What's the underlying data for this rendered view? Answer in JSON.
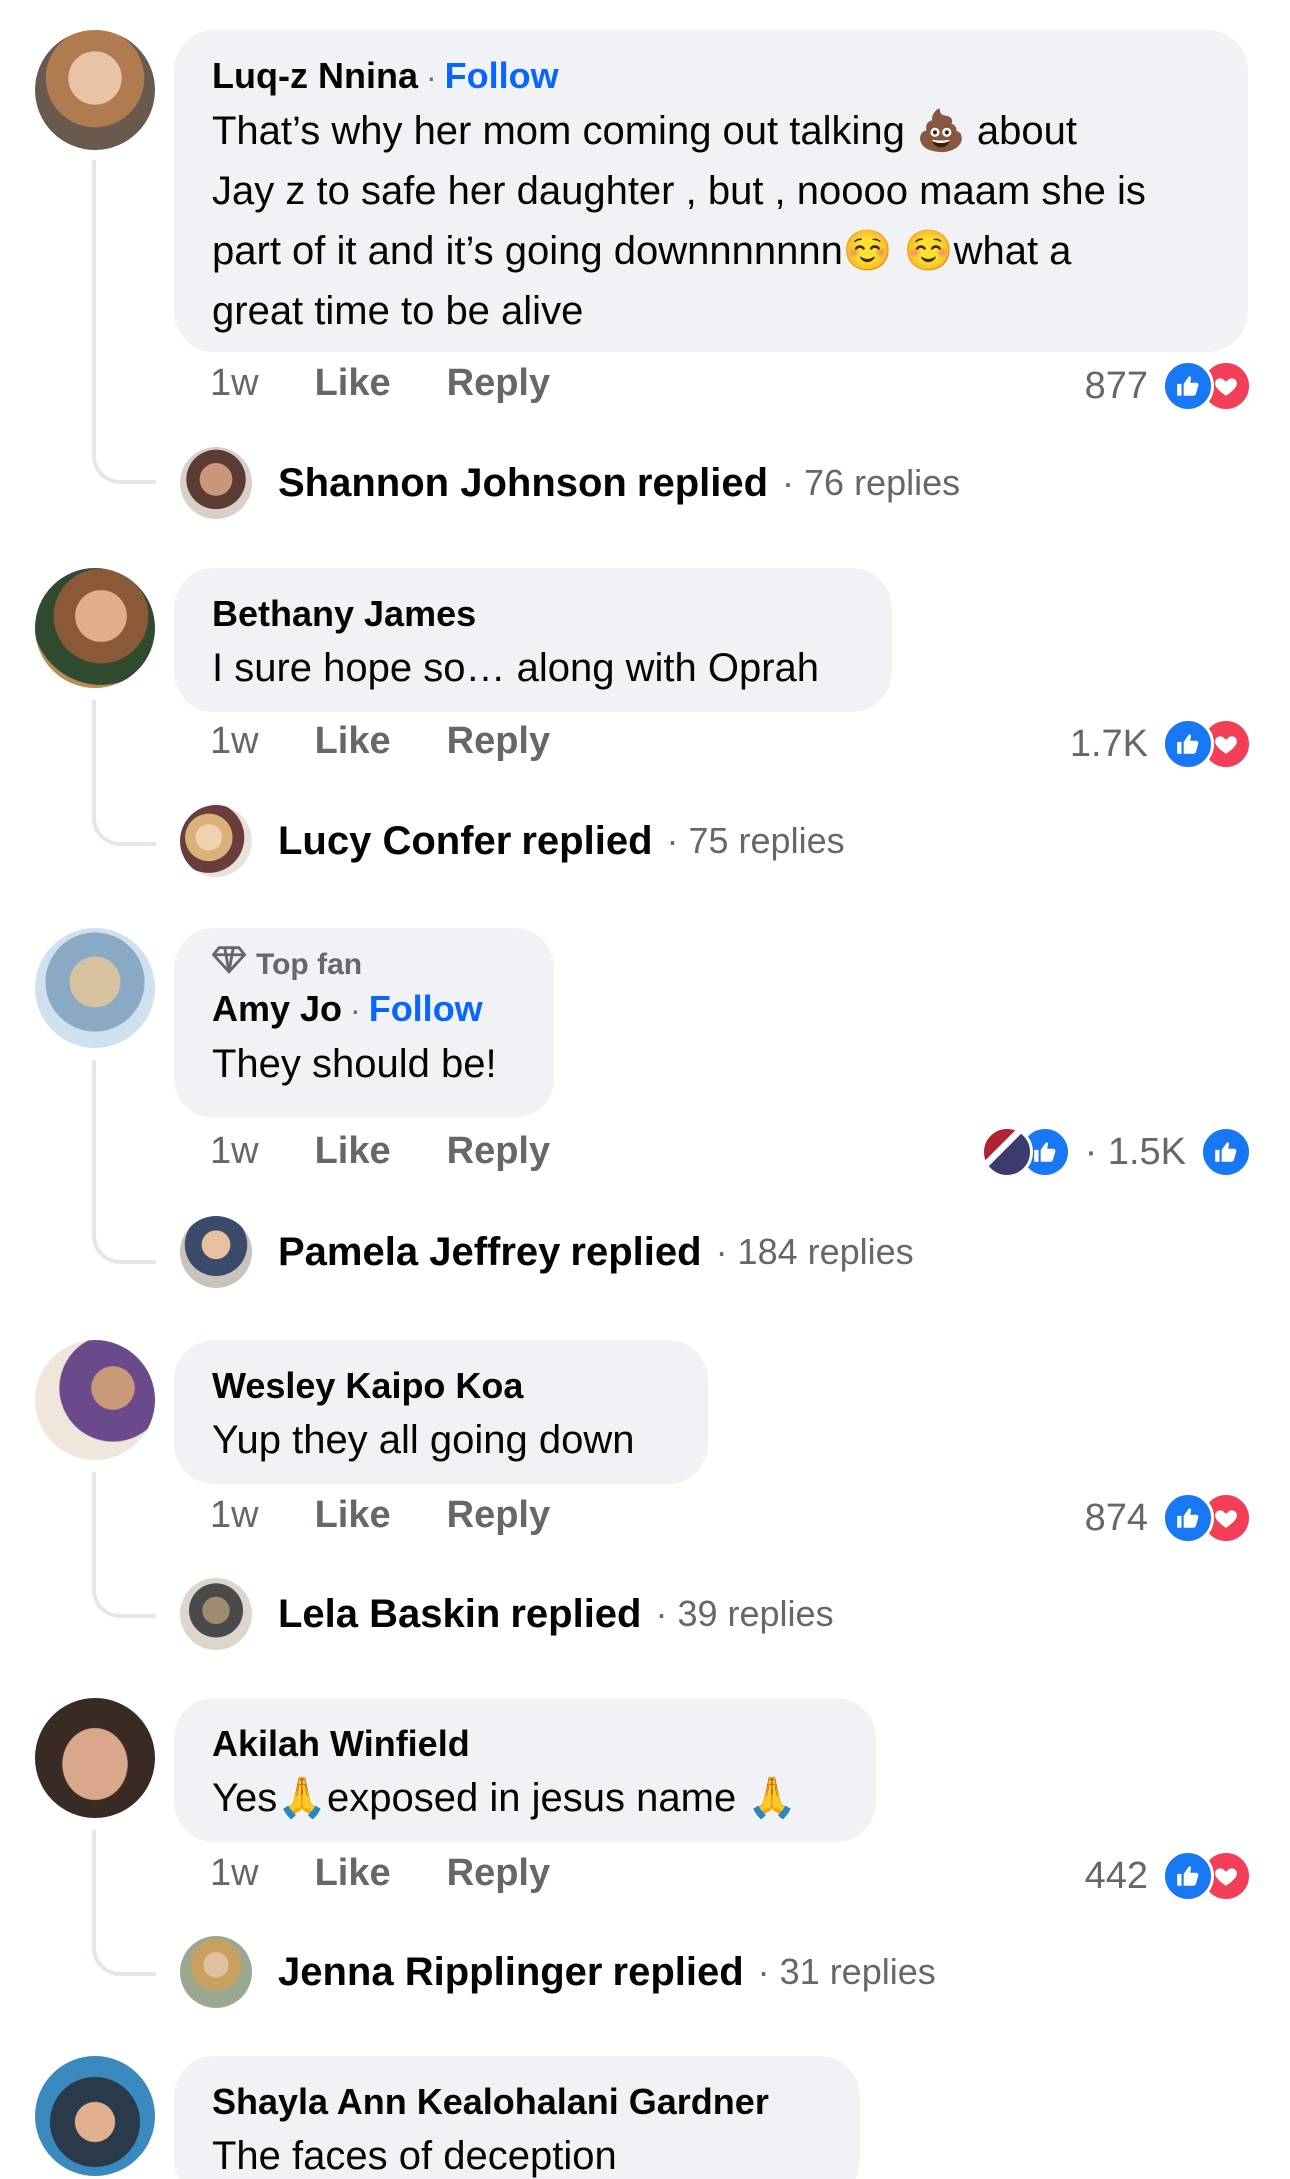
{
  "colors": {
    "like": "#1877f2",
    "love": "#f33e58",
    "follow": "#0866ff",
    "bubble": "#f0f2f5",
    "meta": "#65676b"
  },
  "labels": {
    "like": "Like",
    "reply": "Reply",
    "follow": "Follow",
    "replied": "replied",
    "dot": "·"
  },
  "comments": [
    {
      "name": "Luq-z Nnina",
      "follow": true,
      "text_lines": [
        "That’s why her mom coming out talking 💩  about",
        "Jay z to safe her daughter , but , noooo maam she is",
        "part of it and it’s going downnnnnnn☺️ ☺️what a",
        "great time to be alive"
      ],
      "time": "1w",
      "reaction_count": "877",
      "reactions": [
        "like-icon",
        "love-icon"
      ],
      "reply_name": "Shannon Johnson",
      "reply_count": "· 76 replies"
    },
    {
      "name": "Bethany James",
      "follow": false,
      "text_lines": [
        "I sure hope so… along with Oprah"
      ],
      "time": "1w",
      "reaction_count": "1.7K",
      "reactions": [
        "like-icon",
        "love-icon"
      ],
      "reply_name": "Lucy Confer",
      "reply_count": "· 75 replies"
    },
    {
      "badge": "Top fan",
      "name": "Amy Jo",
      "follow": true,
      "text_lines": [
        "They should be!"
      ],
      "time": "1w",
      "reaction_count": "· 1.5K",
      "reactions": [
        "avatar-stack",
        "like-icon"
      ],
      "reply_name": "Pamela Jeffrey",
      "reply_count": "· 184 replies"
    },
    {
      "name": "Wesley Kaipo Koa",
      "follow": false,
      "text_lines": [
        "Yup they all going down"
      ],
      "time": "1w",
      "reaction_count": "874",
      "reactions": [
        "like-icon",
        "love-icon"
      ],
      "reply_name": "Lela Baskin",
      "reply_count": "· 39 replies"
    },
    {
      "name": "Akilah Winfield",
      "follow": false,
      "text_lines": [
        "Yes🙏exposed in jesus name 🙏"
      ],
      "time": "1w",
      "reaction_count": "442",
      "reactions": [
        "like-icon",
        "love-icon"
      ],
      "reply_name": "Jenna Ripplinger",
      "reply_count": "· 31 replies"
    },
    {
      "name": "Shayla Ann Kealohalani Gardner",
      "follow": false,
      "text_lines": [
        "The faces of deception"
      ]
    }
  ]
}
